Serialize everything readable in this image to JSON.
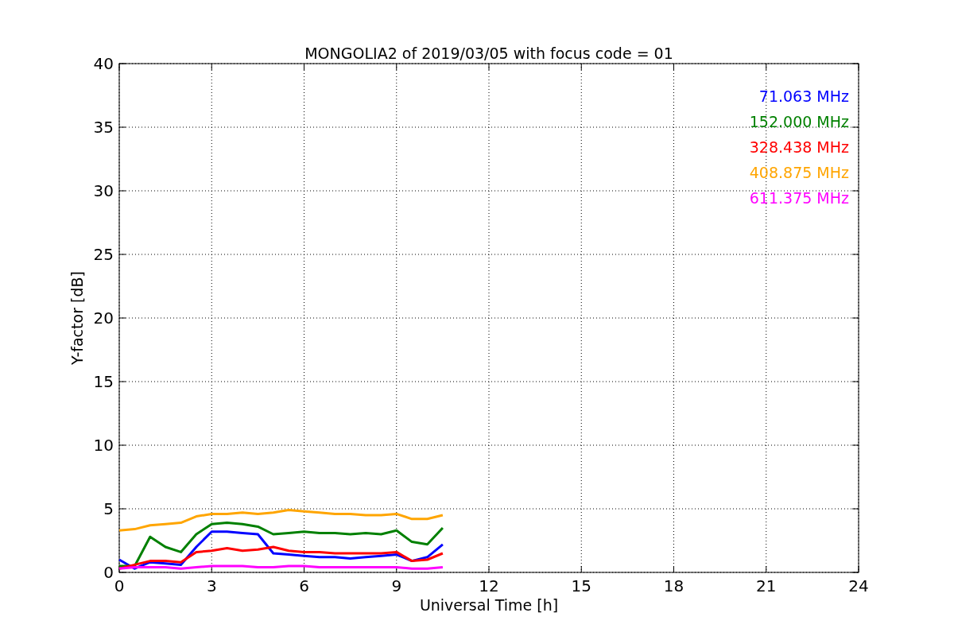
{
  "figure": {
    "chart_data": {
      "type": "line",
      "title": "MONGOLIA2 of 2019/03/05 with focus code = 01",
      "xlabel": "Universal Time [h]",
      "ylabel": "Y-factor [dB]",
      "x": [
        0,
        0.5,
        1,
        1.5,
        2,
        2.5,
        3,
        3.5,
        4,
        4.5,
        5,
        5.5,
        6,
        6.5,
        7,
        7.5,
        8,
        8.5,
        9,
        9.5,
        10,
        10.5
      ],
      "series": [
        {
          "name": "71.063 MHz",
          "color": "#0000ff",
          "values": [
            1.0,
            0.3,
            0.8,
            0.7,
            0.6,
            2.0,
            3.2,
            3.2,
            3.1,
            3.0,
            1.5,
            1.4,
            1.3,
            1.2,
            1.2,
            1.1,
            1.2,
            1.3,
            1.4,
            0.9,
            1.2,
            2.2
          ]
        },
        {
          "name": "152.000 MHz",
          "color": "#008000",
          "values": [
            0.5,
            0.5,
            2.8,
            2.0,
            1.6,
            3.0,
            3.8,
            3.9,
            3.8,
            3.6,
            3.0,
            3.1,
            3.2,
            3.1,
            3.1,
            3.0,
            3.1,
            3.0,
            3.3,
            2.4,
            2.2,
            3.5
          ]
        },
        {
          "name": "328.438 MHz",
          "color": "#ff0000",
          "values": [
            0.3,
            0.6,
            0.9,
            0.9,
            0.8,
            1.6,
            1.7,
            1.9,
            1.7,
            1.8,
            2.0,
            1.7,
            1.6,
            1.6,
            1.5,
            1.5,
            1.5,
            1.5,
            1.6,
            0.9,
            1.0,
            1.5
          ]
        },
        {
          "name": "408.875 MHz",
          "color": "#ffa500",
          "values": [
            3.3,
            3.4,
            3.7,
            3.8,
            3.9,
            4.4,
            4.6,
            4.6,
            4.7,
            4.6,
            4.7,
            4.9,
            4.8,
            4.7,
            4.6,
            4.6,
            4.5,
            4.5,
            4.6,
            4.2,
            4.2,
            4.5
          ]
        },
        {
          "name": "611.375 MHz",
          "color": "#ff00ff",
          "values": [
            0.3,
            0.4,
            0.4,
            0.4,
            0.3,
            0.4,
            0.5,
            0.5,
            0.5,
            0.4,
            0.4,
            0.5,
            0.5,
            0.4,
            0.4,
            0.4,
            0.4,
            0.4,
            0.4,
            0.3,
            0.3,
            0.4
          ]
        }
      ],
      "grid": true,
      "xlim": [
        0,
        24
      ],
      "ylim": [
        0,
        40
      ],
      "xticks": [
        0,
        3,
        6,
        9,
        12,
        15,
        18,
        21,
        24
      ],
      "yticks": [
        0,
        5,
        10,
        15,
        20,
        25,
        30,
        35,
        40
      ]
    }
  }
}
